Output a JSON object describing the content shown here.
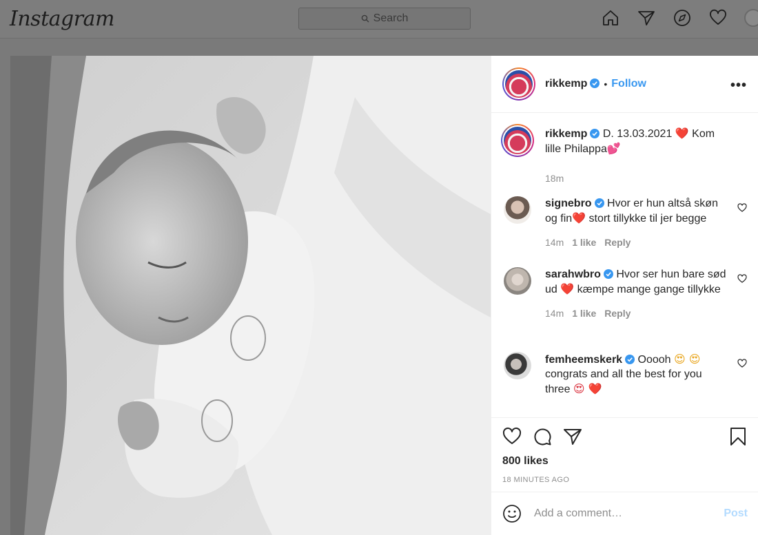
{
  "topbar": {
    "logo": "Instagram",
    "search_placeholder": "Search"
  },
  "post": {
    "username": "rikkemp",
    "follow_label": "Follow",
    "dot": "•",
    "more_label": "•••",
    "caption": {
      "username": "rikkemp",
      "text_before": "D. 13.03.2021 ",
      "emoji1": "❤️",
      "text_after": " Kom lille Philappa",
      "emoji2": "💕",
      "time": "18m"
    },
    "comments": [
      {
        "username": "signebro",
        "text_parts": [
          "Hvor er hun altså skøn og fin",
          "❤️",
          " stort tillykke til jer begge"
        ],
        "time": "14m",
        "likes": "1 like",
        "reply": "Reply"
      },
      {
        "username": "sarahwbro",
        "text_parts": [
          "Hvor ser hun bare sød ud ",
          "❤️",
          " kæmpe mange gange tillykke"
        ],
        "time": "14m",
        "likes": "1 like",
        "reply": "Reply"
      },
      {
        "username": "femheemskerk",
        "text_parts": [
          "Ooooh ",
          "😍 😍",
          " congrats and all the best for you three ",
          "😍 ❤️"
        ]
      }
    ],
    "likes": "800 likes",
    "timestamp": "18 MINUTES AGO",
    "comment_placeholder": "Add a comment…",
    "post_label": "Post"
  },
  "colors": {
    "link_blue": "#3897f0",
    "post_disabled": "#b3dbff",
    "overlay": "#7a7a7a"
  }
}
